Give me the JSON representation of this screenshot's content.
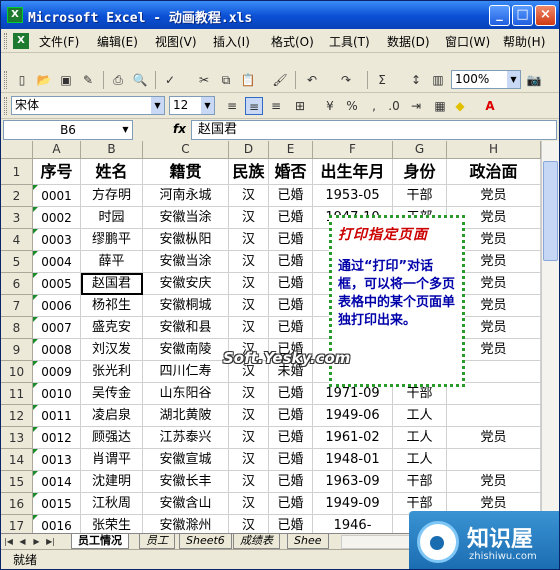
{
  "window": {
    "title": "Microsoft Excel - 动画教程.xls",
    "app_icon": "X",
    "min": "_",
    "max": "□",
    "close": "×"
  },
  "menu": [
    "文件(F)",
    "编辑(E)",
    "视图(V)",
    "插入(I)",
    "格式(O)",
    "工具(T)",
    "数据(D)",
    "窗口(W)",
    "帮助(H)"
  ],
  "toolbar": {
    "zoom": "100%",
    "font": "宋体",
    "size": "12"
  },
  "formula_bar": {
    "name_box": "B6",
    "fx": "fx",
    "content": "赵国君"
  },
  "columns": [
    "A",
    "B",
    "C",
    "D",
    "E",
    "F",
    "G",
    "H"
  ],
  "header_row": [
    "序号",
    "姓名",
    "籍贯",
    "民族",
    "婚否",
    "出生年月",
    "身份",
    "政治面"
  ],
  "rows": [
    [
      "0001",
      "方存明",
      "河南永城",
      "汉",
      "已婚",
      "1953-05",
      "干部",
      "党员"
    ],
    [
      "0002",
      "时园",
      "安徽当涂",
      "汉",
      "已婚",
      "1947-10",
      "干部",
      "党员"
    ],
    [
      "0003",
      "缪鹏平",
      "安徽枞阳",
      "汉",
      "已婚",
      "",
      "",
      "党员"
    ],
    [
      "0004",
      "薛平",
      "安徽当涂",
      "汉",
      "已婚",
      "",
      "",
      "党员"
    ],
    [
      "0005",
      "赵国君",
      "安徽安庆",
      "汉",
      "已婚",
      "",
      "",
      "党员"
    ],
    [
      "0006",
      "杨祁生",
      "安徽桐城",
      "汉",
      "已婚",
      "",
      "",
      "党员"
    ],
    [
      "0007",
      "盛克安",
      "安徽和县",
      "汉",
      "已婚",
      "",
      "",
      "党员"
    ],
    [
      "0008",
      "刘汉发",
      "安徽南陵",
      "汉",
      "已婚",
      "",
      "",
      "党员"
    ],
    [
      "0009",
      "张光利",
      "四川仁寿",
      "汉",
      "未婚",
      "",
      "",
      ""
    ],
    [
      "0010",
      "吴传金",
      "山东阳谷",
      "汉",
      "已婚",
      "1971-09",
      "干部",
      ""
    ],
    [
      "0011",
      "凌启泉",
      "湖北黄陂",
      "汉",
      "已婚",
      "1949-06",
      "工人",
      ""
    ],
    [
      "0012",
      "顾强达",
      "江苏泰兴",
      "汉",
      "已婚",
      "1961-02",
      "工人",
      "党员"
    ],
    [
      "0013",
      "肖谓平",
      "安徽宣城",
      "汉",
      "已婚",
      "1948-01",
      "工人",
      ""
    ],
    [
      "0014",
      "沈建明",
      "安徽长丰",
      "汉",
      "已婚",
      "1963-09",
      "干部",
      "党员"
    ],
    [
      "0015",
      "江秋周",
      "安徽含山",
      "汉",
      "已婚",
      "1949-09",
      "干部",
      "党员"
    ],
    [
      "0016",
      "张荣生",
      "安徽滁州",
      "汉",
      "已婚",
      "1946-",
      "",
      "党员"
    ]
  ],
  "callout": {
    "title": "打印指定页面",
    "body": "通过“打印”对话框，可以将一个多页表格中的某个页面单独打印出来。"
  },
  "watermark": "Soft.Yesky.com",
  "sheet_tabs": [
    "员工情况",
    "员工",
    "Sheet6",
    "成绩表",
    "Shee"
  ],
  "status": "就绪",
  "logo": {
    "zh": "知识屋",
    "en": "zhishiwu.com"
  }
}
